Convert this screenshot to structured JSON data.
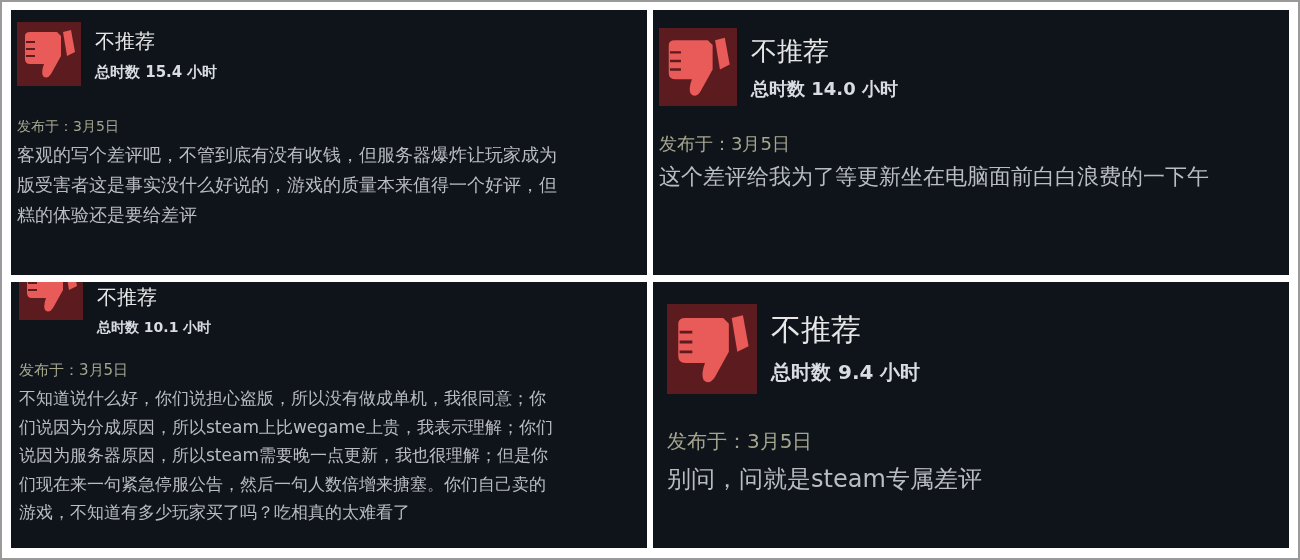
{
  "reviews": [
    {
      "verdict": "不推荐",
      "hours": "总时数 15.4 小时",
      "posted": "发布于：3月5日",
      "lines": [
        "客观的写个差评吧，不管到底有没有收钱，但服务器爆炸让玩家成为",
        "版受害者这是事实没什么好说的，游戏的质量本来值得一个好评，但",
        "糕的体验还是要给差评"
      ]
    },
    {
      "verdict": "不推荐",
      "hours": "总时数 14.0 小时",
      "posted": "发布于：3月5日",
      "lines": [
        "这个差评给我为了等更新坐在电脑面前白白浪费的一下午"
      ]
    },
    {
      "verdict": "不推荐",
      "hours": "总时数 10.1 小时",
      "posted": "发布于：3月5日",
      "lines": [
        "不知道说什么好，你们说担心盗版，所以没有做成单机，我很同意；你",
        "们说因为分成原因，所以steam上比wegame上贵，我表示理解；你们",
        "说因为服务器原因，所以steam需要晚一点更新，我也很理解；但是你",
        "们现在来一句紧急停服公告，然后一句人数倍增来搪塞。你们自己卖的",
        "游戏，不知道有多少玩家买了吗？吃相真的太难看了"
      ]
    },
    {
      "verdict": "不推荐",
      "hours": "总时数 9.4 小时",
      "posted": "发布于：3月5日",
      "lines": [
        "别问，问就是steam专属差评"
      ]
    }
  ]
}
